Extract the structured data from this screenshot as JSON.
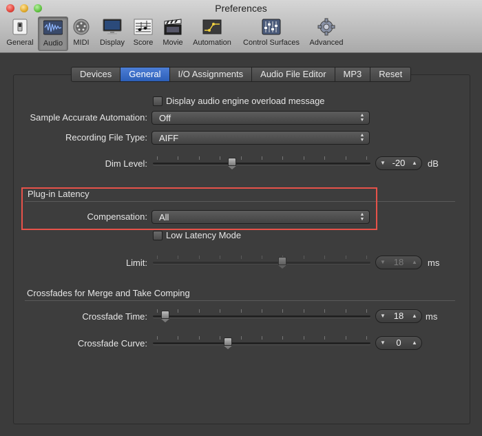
{
  "window": {
    "title": "Preferences"
  },
  "toolbar": [
    {
      "label": "General",
      "icon": "switch-icon"
    },
    {
      "label": "Audio",
      "icon": "audio-waveform-icon",
      "selected": true
    },
    {
      "label": "MIDI",
      "icon": "midi-connector-icon"
    },
    {
      "label": "Display",
      "icon": "monitor-icon"
    },
    {
      "label": "Score",
      "icon": "music-notes-icon"
    },
    {
      "label": "Movie",
      "icon": "clapperboard-icon"
    },
    {
      "label": "Automation",
      "icon": "automation-curve-icon"
    },
    {
      "label": "Control Surfaces",
      "icon": "mixer-faders-icon"
    },
    {
      "label": "Advanced",
      "icon": "gear-icon"
    }
  ],
  "tabs": [
    {
      "label": "Devices"
    },
    {
      "label": "General",
      "active": true
    },
    {
      "label": "I/O Assignments"
    },
    {
      "label": "Audio File Editor"
    },
    {
      "label": "MP3"
    },
    {
      "label": "Reset"
    }
  ],
  "general": {
    "display_overload_label": "Display audio engine overload message",
    "sample_accurate_label": "Sample Accurate Automation:",
    "sample_accurate_value": "Off",
    "recording_file_type_label": "Recording File Type:",
    "recording_file_type_value": "AIFF",
    "dim_level_label": "Dim Level:",
    "dim_level_value": "-20",
    "dim_level_unit": "dB",
    "dim_level_fraction": 0.36
  },
  "plugin_latency": {
    "section_title": "Plug-in Latency",
    "compensation_label": "Compensation:",
    "compensation_value": "All",
    "low_latency_label": "Low Latency Mode",
    "limit_label": "Limit:",
    "limit_value": "18",
    "limit_unit": "ms",
    "limit_fraction": 0.6
  },
  "crossfades": {
    "section_title": "Crossfades for Merge and Take Comping",
    "crossfade_time_label": "Crossfade Time:",
    "crossfade_time_value": "18",
    "crossfade_time_unit": "ms",
    "crossfade_time_fraction": 0.04,
    "crossfade_curve_label": "Crossfade Curve:",
    "crossfade_curve_value": "0",
    "crossfade_curve_fraction": 0.34
  },
  "colors": {
    "accent": "#2c5fb8",
    "highlight": "#e8524a"
  }
}
